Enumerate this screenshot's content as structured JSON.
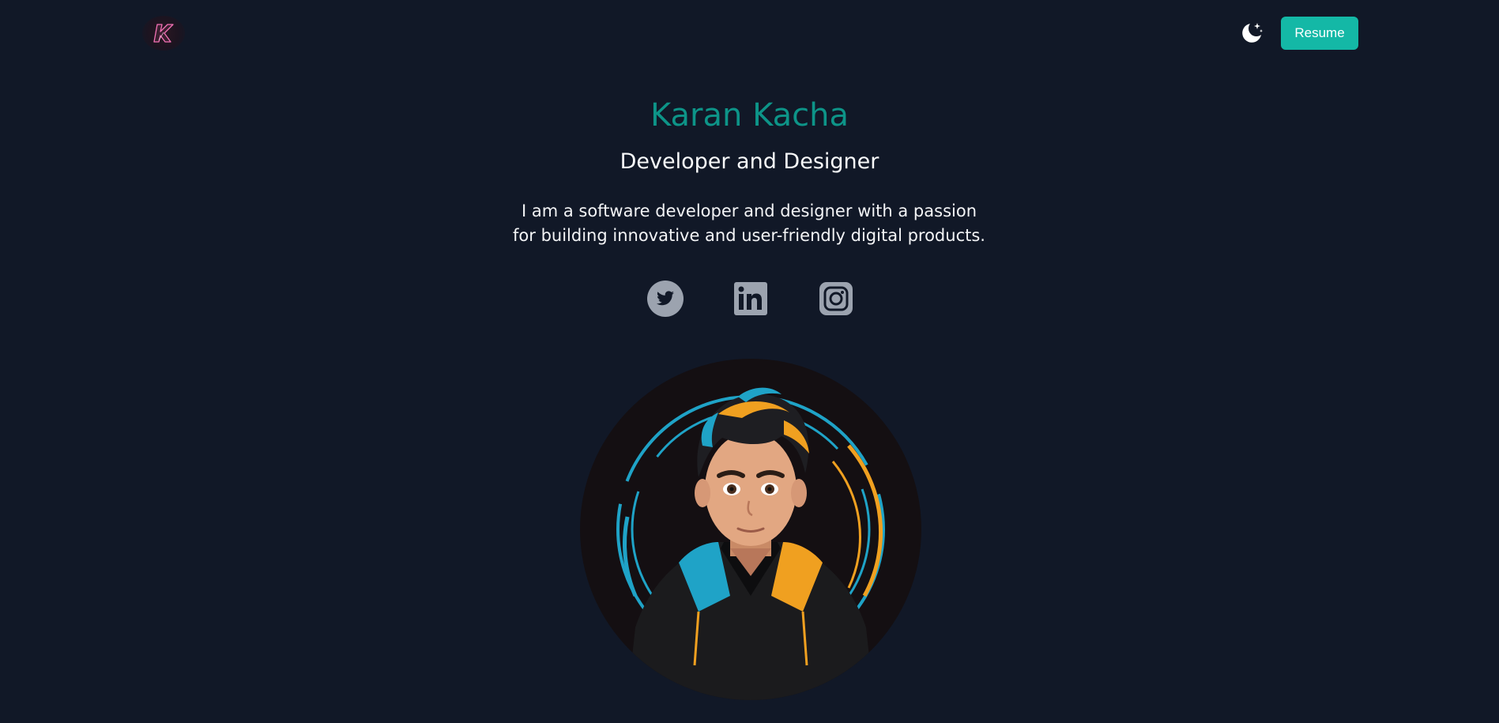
{
  "header": {
    "logo_letter": "K",
    "theme_toggle_icon": "moon-stars-icon",
    "resume_label": "Resume"
  },
  "hero": {
    "name": "Karan Kacha",
    "role": "Developer and Designer",
    "bio": "I am a software developer and designer with a passion for building innovative and user-friendly digital products."
  },
  "socials": [
    {
      "icon": "twitter-icon"
    },
    {
      "icon": "linkedin-icon"
    },
    {
      "icon": "instagram-icon"
    }
  ],
  "colors": {
    "background": "#111827",
    "accent": "#14b8a6",
    "name_color": "#0d9488",
    "icon_color": "#9ca3af"
  }
}
